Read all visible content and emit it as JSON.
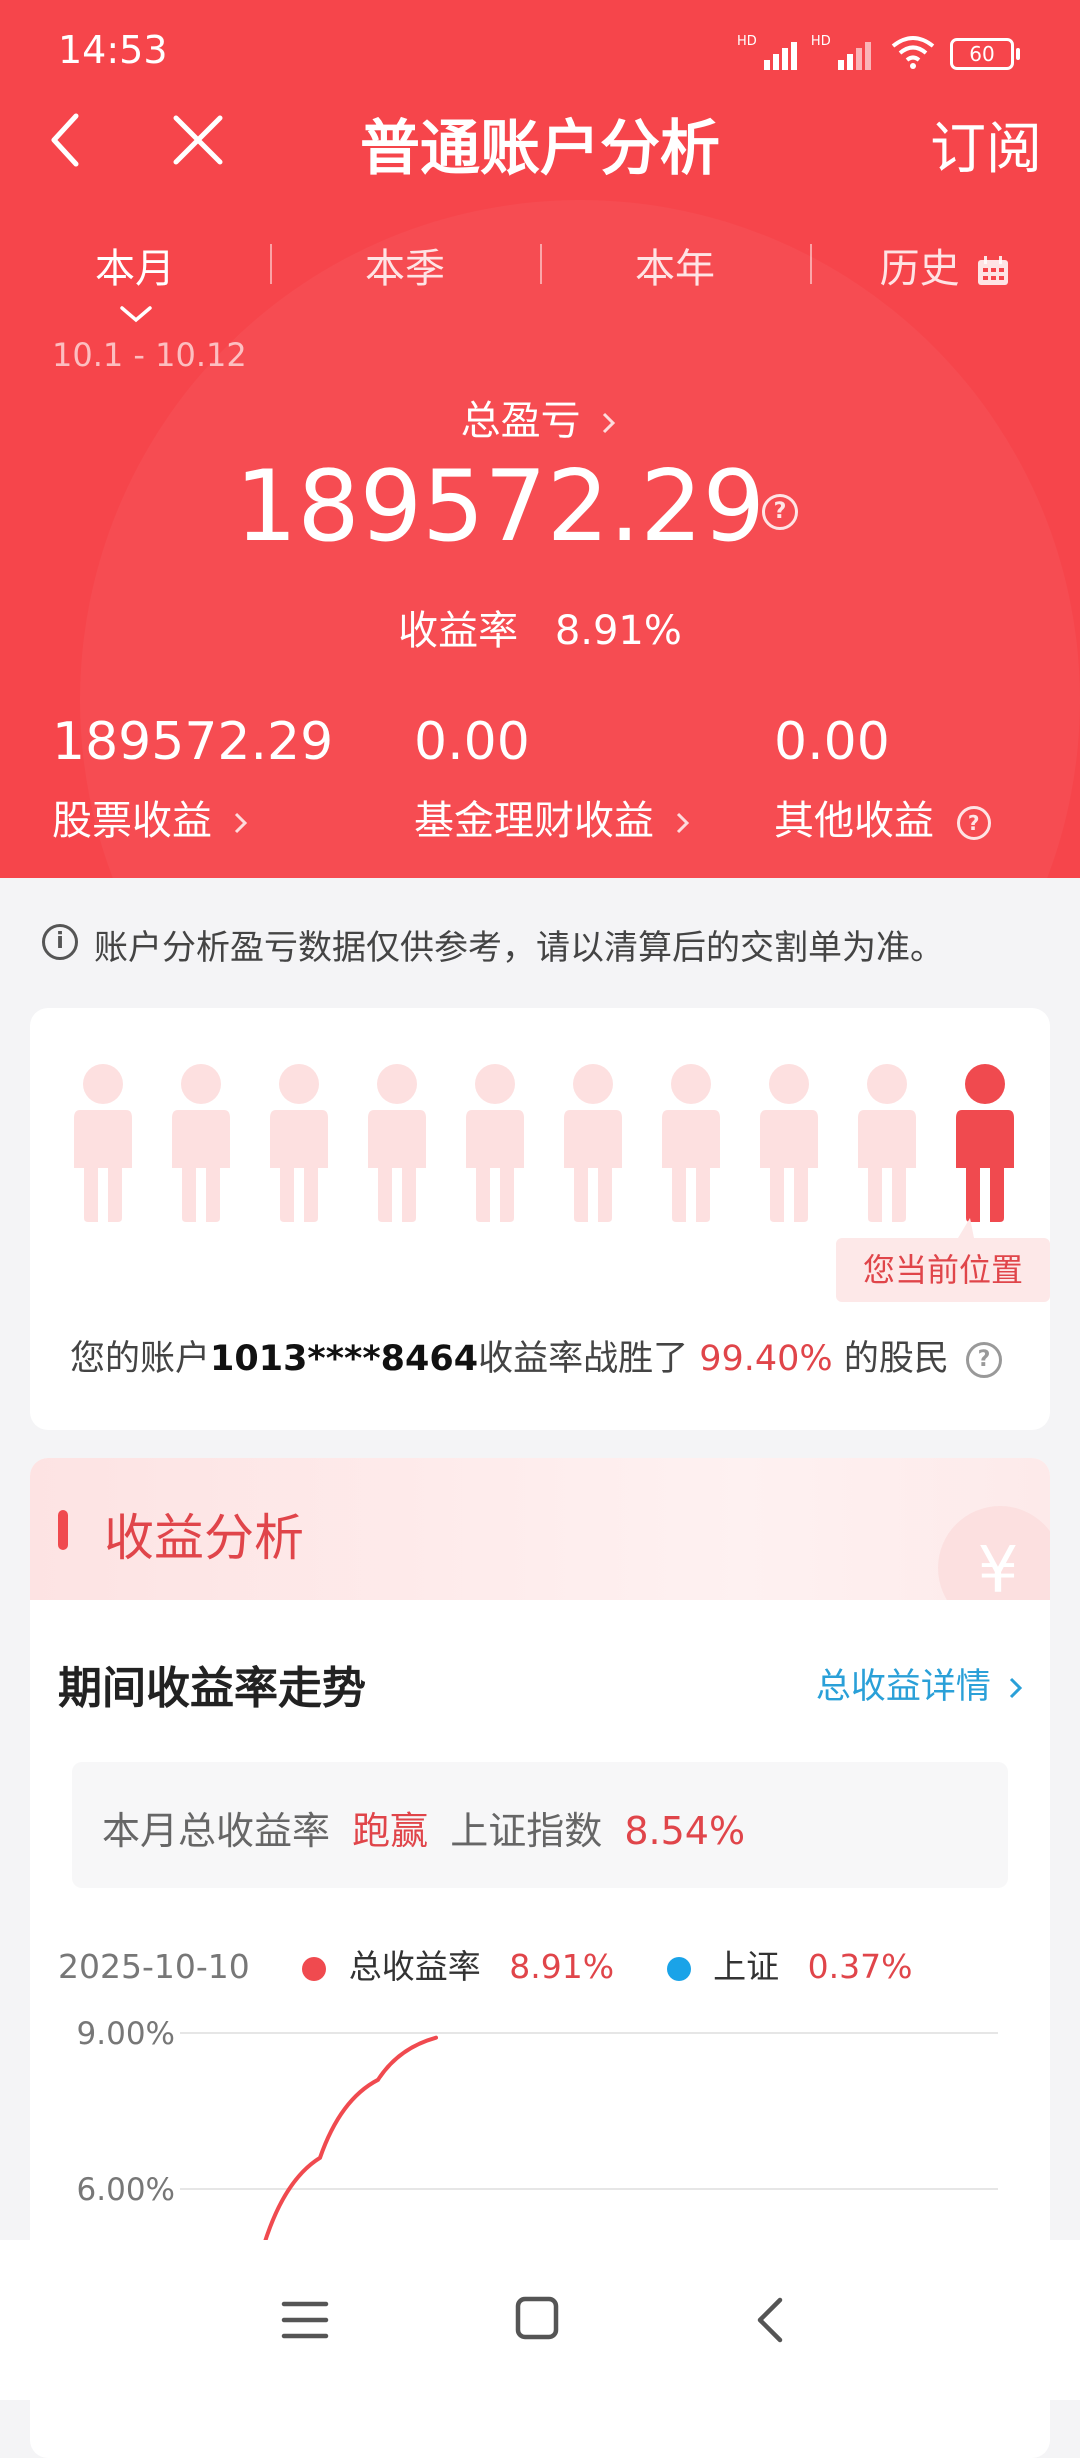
{
  "status_bar": {
    "time": "14:53",
    "network": [
      "HD",
      "HD"
    ],
    "battery": "60"
  },
  "header": {
    "title": "普通账户分析",
    "subscribe": "订阅",
    "tabs": [
      "本月",
      "本季",
      "本年",
      "历史"
    ],
    "date_range": "10.1 - 10.12",
    "total_label": "总盈亏",
    "total_value": "189572.29",
    "return_label": "收益率",
    "return_value": "8.91%",
    "stats": [
      {
        "value": "189572.29",
        "label": "股票收益"
      },
      {
        "value": "0.00",
        "label": "基金理财收益"
      },
      {
        "value": "0.00",
        "label": "其他收益"
      }
    ]
  },
  "notice": "账户分析盈亏数据仅供参考，请以清算后的交割单为准。",
  "ranking": {
    "position_label": "您当前位置",
    "text_prefix": "您的账户",
    "account": "1013****8464",
    "text_mid": "收益率战胜了",
    "percent": "99.40%",
    "text_suffix": "的股民",
    "highlight_index": 10
  },
  "analysis": {
    "section_title": "收益分析",
    "trend_title": "期间收益率走势",
    "detail_link": "总收益详情",
    "compare": {
      "prefix": "本月总收益率",
      "result": "跑赢",
      "index_label": "上证指数",
      "index_value": "8.54%"
    }
  },
  "chart_legend": {
    "date": "2025-10-10",
    "series": [
      {
        "name": "总收益率",
        "value": "8.91%",
        "color": "#f04a4f"
      },
      {
        "name": "上证",
        "value": "0.37%",
        "color": "#1aa3e8"
      }
    ]
  },
  "chart_data": {
    "type": "line",
    "ytick_labels": [
      "9.00%",
      "6.00%"
    ],
    "yticks": [
      9.0,
      6.0
    ],
    "series": [
      {
        "name": "总收益率",
        "x": [
          0,
          1,
          2,
          3
        ],
        "values": [
          4.8,
          6.6,
          8.1,
          8.91
        ]
      }
    ]
  },
  "colors": {
    "brand_red": "#f6454b",
    "accent_red": "#e0454a",
    "link_blue": "#2aa0d8"
  }
}
